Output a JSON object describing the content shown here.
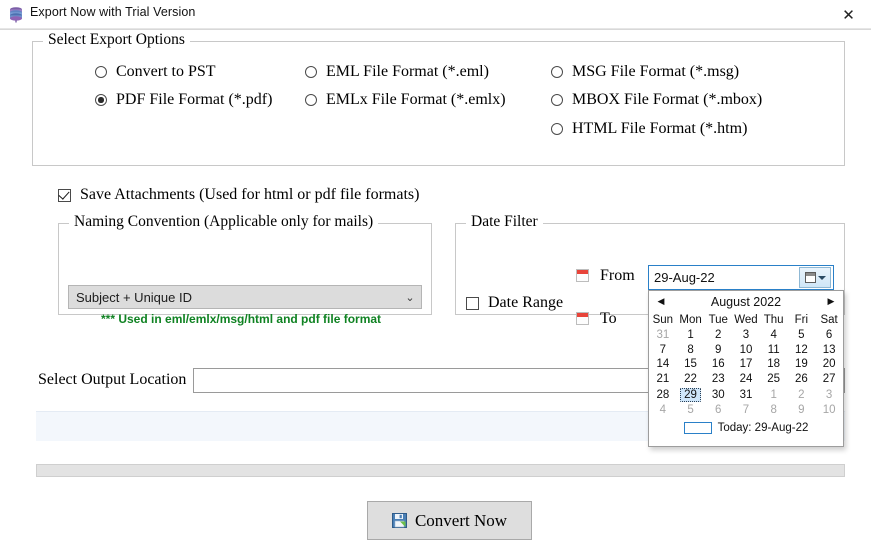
{
  "titlebar": {
    "title": "Export Now with Trial Version",
    "icon": "database-stack-icon",
    "close_label": "✕"
  },
  "export_options": {
    "legend": "Select Export Options",
    "items": [
      {
        "label": "Convert to PST",
        "checked": false
      },
      {
        "label": "PDF File Format (*.pdf)",
        "checked": true
      },
      {
        "label": "EML File  Format (*.eml)",
        "checked": false
      },
      {
        "label": "EMLx File  Format (*.emlx)",
        "checked": false
      },
      {
        "label": "MSG File Format (*.msg)",
        "checked": false
      },
      {
        "label": "MBOX File Format (*.mbox)",
        "checked": false
      },
      {
        "label": "HTML File  Format (*.htm)",
        "checked": false
      }
    ]
  },
  "save_attachments": {
    "label": "Save Attachments (Used for html or pdf file formats)",
    "checked": true
  },
  "naming": {
    "legend": "Naming Convention (Applicable only for mails)",
    "selected": "Subject + Unique ID",
    "options": [
      "Subject + Unique ID"
    ],
    "arrow": "⌄",
    "hint": "*** Used in eml/emlx/msg/html and pdf file format",
    "hint_color": "#0f8222"
  },
  "date_filter": {
    "legend": "Date Filter",
    "date_range_label": "Date Range",
    "date_range_checked": false,
    "from_label": "From",
    "to_label": "To",
    "from_value": "29-Aug-22",
    "to_value": ""
  },
  "calendar": {
    "month_title": "August 2022",
    "prev_arrow": "◀",
    "next_arrow": "▶",
    "weekdays": [
      "Sun",
      "Mon",
      "Tue",
      "Wed",
      "Thu",
      "Fri",
      "Sat"
    ],
    "weeks": [
      [
        {
          "d": "31",
          "dim": true
        },
        {
          "d": "1"
        },
        {
          "d": "2"
        },
        {
          "d": "3"
        },
        {
          "d": "4"
        },
        {
          "d": "5"
        },
        {
          "d": "6"
        }
      ],
      [
        {
          "d": "7"
        },
        {
          "d": "8"
        },
        {
          "d": "9"
        },
        {
          "d": "10"
        },
        {
          "d": "11"
        },
        {
          "d": "12"
        },
        {
          "d": "13"
        }
      ],
      [
        {
          "d": "14"
        },
        {
          "d": "15"
        },
        {
          "d": "16"
        },
        {
          "d": "17"
        },
        {
          "d": "18"
        },
        {
          "d": "19"
        },
        {
          "d": "20"
        }
      ],
      [
        {
          "d": "21"
        },
        {
          "d": "22"
        },
        {
          "d": "23"
        },
        {
          "d": "24"
        },
        {
          "d": "25"
        },
        {
          "d": "26"
        },
        {
          "d": "27"
        }
      ],
      [
        {
          "d": "28"
        },
        {
          "d": "29",
          "selected": true
        },
        {
          "d": "30"
        },
        {
          "d": "31"
        },
        {
          "d": "1",
          "dim": true
        },
        {
          "d": "2",
          "dim": true
        },
        {
          "d": "3",
          "dim": true
        }
      ],
      [
        {
          "d": "4",
          "dim": true
        },
        {
          "d": "5",
          "dim": true
        },
        {
          "d": "6",
          "dim": true
        },
        {
          "d": "7",
          "dim": true
        },
        {
          "d": "8",
          "dim": true
        },
        {
          "d": "9",
          "dim": true
        },
        {
          "d": "10",
          "dim": true
        }
      ]
    ],
    "today_text": "Today: 29-Aug-22",
    "selected_color": "#cfe6fa",
    "accent_color": "#2a80c8"
  },
  "output": {
    "label": "Select Output Location",
    "value": "",
    "placeholder": ""
  },
  "footer": {
    "convert_label": "Convert Now",
    "convert_icon": "save-disk-icon"
  }
}
